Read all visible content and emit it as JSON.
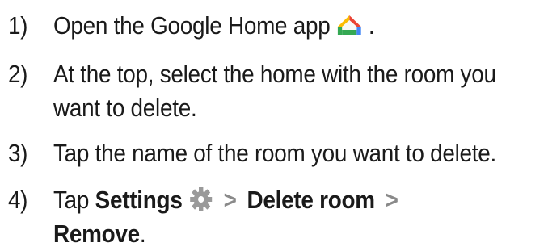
{
  "steps": [
    {
      "number": "1)",
      "text_before": "Open the Google Home app",
      "icon": "google-home-icon",
      "text_after": "."
    },
    {
      "number": "2)",
      "line1": "At the top, select the home with the room you",
      "line2": "want to delete."
    },
    {
      "number": "3)",
      "text": "Tap the name of the room you want to delete."
    },
    {
      "number": "4)",
      "text_tap": "Tap",
      "settings_label": "Settings",
      "icon": "gear-icon",
      "separator": ">",
      "delete_label": "Delete room",
      "separator2": ">",
      "remove_label": "Remove",
      "text_after": "."
    }
  ],
  "colors": {
    "text": "#1a1a1a",
    "icon_gray": "#9a9a9a",
    "home_red": "#ea4335",
    "home_yellow": "#fbbc04",
    "home_green": "#34a853",
    "home_blue": "#4285f4"
  }
}
